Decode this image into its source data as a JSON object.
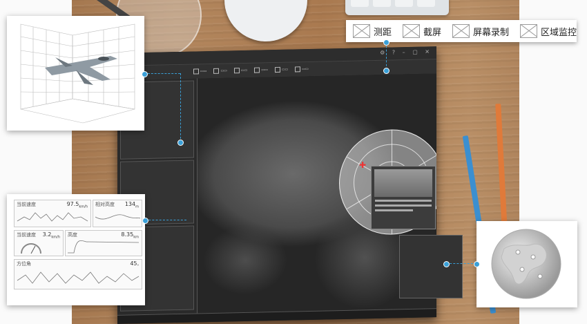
{
  "top_menu": {
    "items": [
      {
        "label": "测距",
        "icon": "distance-measure-icon"
      },
      {
        "label": "截屏",
        "icon": "screenshot-icon"
      },
      {
        "label": "屏幕录制",
        "icon": "screen-record-icon"
      },
      {
        "label": "区域监控",
        "icon": "area-monitor-icon"
      }
    ]
  },
  "chart_panel": {
    "charts": [
      {
        "label": "当前速度",
        "value": "97.5",
        "unit": "km/h"
      },
      {
        "label": "相对高度",
        "value": "134",
        "unit": "m"
      },
      {
        "label": "当前速度",
        "value": "3.2",
        "unit": "km/h"
      },
      {
        "label": "高度",
        "value": "8.35",
        "unit": "km"
      },
      {
        "label": "方位角",
        "value": "45",
        "unit": "°"
      }
    ]
  },
  "colors": {
    "accent": "#3aa0d8",
    "screen_bg": "#222222",
    "target_marker": "#e33333"
  }
}
